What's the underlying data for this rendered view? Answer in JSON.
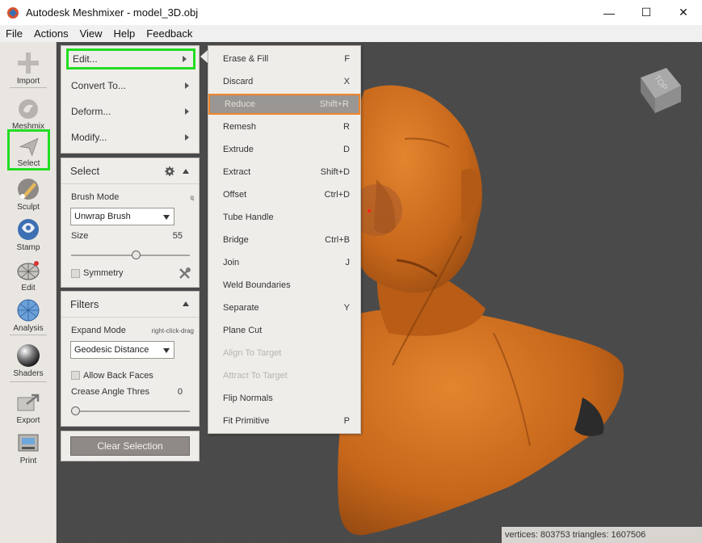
{
  "window": {
    "title": "Autodesk Meshmixer - model_3D.obj",
    "minimize": "—",
    "maximize": "☐",
    "close": "✕"
  },
  "menubar": [
    "File",
    "Actions",
    "View",
    "Help",
    "Feedback"
  ],
  "toolbar": [
    {
      "label": "Import",
      "icon": "plus-icon"
    },
    {
      "label": "Meshmix",
      "icon": "bunny-icon"
    },
    {
      "label": "Select",
      "icon": "select-arrow-icon"
    },
    {
      "label": "Sculpt",
      "icon": "brush-icon"
    },
    {
      "label": "Stamp",
      "icon": "stamp-icon"
    },
    {
      "label": "Edit",
      "icon": "edit-mesh-icon"
    },
    {
      "label": "Analysis",
      "icon": "analysis-sphere-icon"
    },
    {
      "label": "Shaders",
      "icon": "shader-ball-icon"
    },
    {
      "label": "Export",
      "icon": "export-icon"
    },
    {
      "label": "Print",
      "icon": "printer-icon"
    }
  ],
  "edit_panel": {
    "items": [
      "Edit...",
      "Convert To...",
      "Deform...",
      "Modify..."
    ]
  },
  "select_panel": {
    "title": "Select",
    "brush_mode_label": "Brush Mode",
    "brush_mode_hint": "q",
    "brush_mode_value": "Unwrap Brush",
    "size_label": "Size",
    "size_value": "55",
    "size_fraction": 0.55,
    "symmetry_label": "Symmetry"
  },
  "filters_panel": {
    "title": "Filters",
    "expand_mode_label": "Expand Mode",
    "expand_mode_hint": "right-click-drag",
    "expand_mode_value": "Geodesic Distance",
    "allow_back_faces_label": "Allow Back Faces",
    "crease_label": "Crease Angle Thres",
    "crease_value": "0",
    "crease_fraction": 0
  },
  "clear_selection_label": "Clear Selection",
  "edit_submenu": [
    {
      "label": "Erase & Fill",
      "shortcut": "F"
    },
    {
      "label": "Discard",
      "shortcut": "X"
    },
    {
      "label": "Reduce",
      "shortcut": "Shift+R"
    },
    {
      "label": "Remesh",
      "shortcut": "R"
    },
    {
      "label": "Extrude",
      "shortcut": "D"
    },
    {
      "label": "Extract",
      "shortcut": "Shift+D"
    },
    {
      "label": "Offset",
      "shortcut": "Ctrl+D"
    },
    {
      "label": "Tube Handle",
      "shortcut": ""
    },
    {
      "label": "Bridge",
      "shortcut": "Ctrl+B"
    },
    {
      "label": "Join",
      "shortcut": "J"
    },
    {
      "label": "Weld Boundaries",
      "shortcut": ""
    },
    {
      "label": "Separate",
      "shortcut": "Y"
    },
    {
      "label": "Plane Cut",
      "shortcut": ""
    },
    {
      "label": "Align To Target",
      "shortcut": ""
    },
    {
      "label": "Attract To Target",
      "shortcut": ""
    },
    {
      "label": "Flip Normals",
      "shortcut": ""
    },
    {
      "label": "Fit Primitive",
      "shortcut": "P"
    }
  ],
  "navcube_label": "TOP",
  "status": "vertices: 803753 triangles: 1607506",
  "colors": {
    "model": "#c5661a",
    "highlight_green": "#22dd22",
    "highlight_orange": "#f0852b"
  }
}
